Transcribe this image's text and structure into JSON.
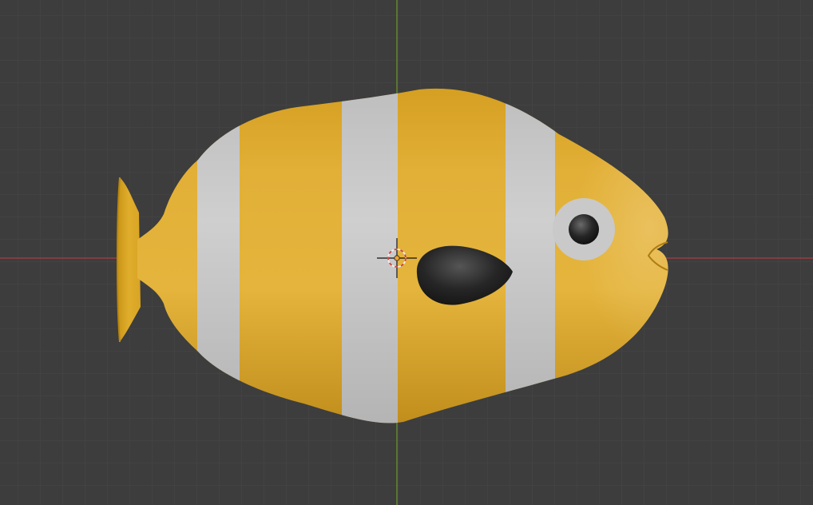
{
  "viewport": {
    "mode": "3d-viewport",
    "view": "top-orthographic",
    "shading": "solid",
    "grid": true,
    "x_axis_visible": true,
    "y_axis_visible": true,
    "scene_object": "clownfish-model"
  },
  "colors": {
    "background": "#3d3d3d",
    "grid_minor": "#474747",
    "grid_major": "#4d4d4d",
    "x_axis": "#a83e42",
    "y_axis": "#6a9a2c",
    "fish_body": "#e0ad2c",
    "fish_stripe": "#c8c8c8",
    "fin_dark": "#1e1e1e",
    "eye_ring": "#c9c9c9",
    "pupil": "#1c1c1c",
    "cursor_ring_red": "#d0403b",
    "cursor_ring_white": "#f0f0f0",
    "origin_dot": "#f0a030"
  },
  "icons": {
    "cursor": "3d-cursor-icon",
    "origin": "object-origin-icon"
  }
}
